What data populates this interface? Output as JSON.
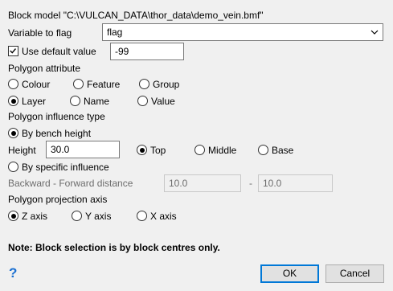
{
  "block_model": {
    "label": "Block model \"C:\\VULCAN_DATA\\thor_data\\demo_vein.bmf\""
  },
  "variable_to_flag": {
    "label": "Variable to flag",
    "value": "flag"
  },
  "default_value": {
    "label": "Use default value",
    "checked": true,
    "value": "-99"
  },
  "polygon_attribute": {
    "title": "Polygon attribute",
    "options": [
      "Colour",
      "Feature",
      "Group",
      "Layer",
      "Name",
      "Value"
    ],
    "selected": "Layer"
  },
  "polygon_influence_type": {
    "title": "Polygon influence type",
    "by_bench_height": "By bench height",
    "height_label": "Height",
    "height_value": "30.0",
    "position_options": [
      "Top",
      "Middle",
      "Base"
    ],
    "position_selected": "Top",
    "by_specific_influence": "By specific influence",
    "backward_forward_label": "Backward - Forward distance",
    "backward_value": "10.0",
    "separator": "-",
    "forward_value": "10.0",
    "selected": "By bench height"
  },
  "polygon_projection_axis": {
    "title": "Polygon projection axis",
    "options": [
      "Z axis",
      "Y axis",
      "X axis"
    ],
    "selected": "Z axis"
  },
  "note": "Note: Block selection is by block centres only.",
  "buttons": {
    "help": "?",
    "ok": "OK",
    "cancel": "Cancel"
  },
  "icons": {
    "combo": "chevron-down-icon",
    "help": "help-icon"
  },
  "colors": {
    "accent": "#0078d7",
    "help": "#1a6fd1"
  }
}
